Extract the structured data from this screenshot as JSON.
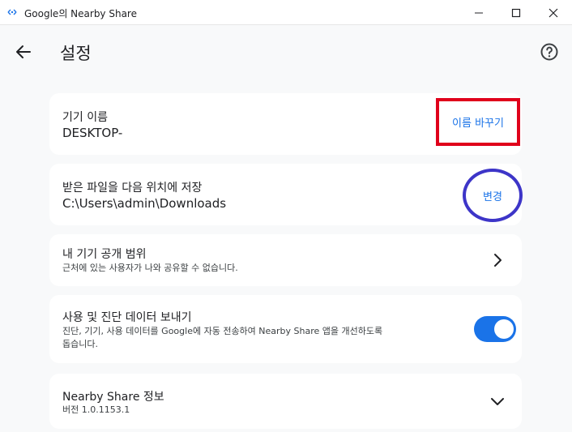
{
  "window": {
    "title": "Google의 Nearby Share"
  },
  "header": {
    "title": "설정"
  },
  "device_name": {
    "label": "기기 이름",
    "value": "DESKTOP-",
    "action": "이름 바꾸기"
  },
  "save_location": {
    "label": "받은 파일을 다음 위치에 저장",
    "value": "C:\\Users\\admin\\Downloads",
    "action": "변경"
  },
  "visibility": {
    "label": "내 기기 공개 범위",
    "description": "근처에 있는 사용자가 나와 공유할 수 없습니다."
  },
  "usage": {
    "label": "사용 및 진단 데이터 보내기",
    "description_line1": "진단, 기기, 사용 데이터를 Google에 자동 전송하여 Nearby Share 앱을 개선하도록",
    "description_line2": "돕습니다.",
    "enabled": true
  },
  "about": {
    "label": "Nearby Share 정보",
    "version": "버전 1.0.1153.1"
  },
  "colors": {
    "accent": "#1a73e8",
    "annotation_red": "#e0001b",
    "annotation_blue": "#3d35c8"
  }
}
